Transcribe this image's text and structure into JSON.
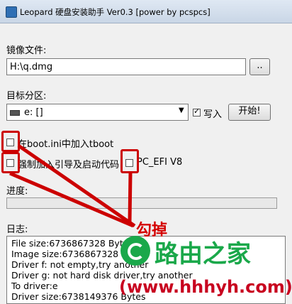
{
  "window": {
    "title": "Leopard 硬盘安装助手 Ver0.3 [power by pcspcs]"
  },
  "image": {
    "label": "镜像文件:",
    "value": "H:\\q.dmg",
    "browse_label": ".."
  },
  "target": {
    "label": "目标分区:",
    "selected": "e: []",
    "write_label": "写入",
    "write_checked": true,
    "start_label": "开始!"
  },
  "options": {
    "tboot_label": "在boot.ini中加入tboot",
    "force_label": "强制加入引导及启动代码",
    "efi_label": "PC_EFI V8"
  },
  "progress": {
    "label": "进度:",
    "value": 0
  },
  "log": {
    "label": "日志:",
    "lines": [
      "File size:6736867328 Bytes",
      "Image size:6736867328 Bytes",
      "Driver f: not empty,try another",
      "Driver g: not hard disk driver,try another",
      "To driver:e",
      "Driver size:6738149376 Bytes"
    ]
  },
  "annotation": {
    "text": "勾掉",
    "color": "#cc0000"
  },
  "watermark": {
    "name": "路由之家",
    "url": "(www.hhhyh.com)"
  }
}
